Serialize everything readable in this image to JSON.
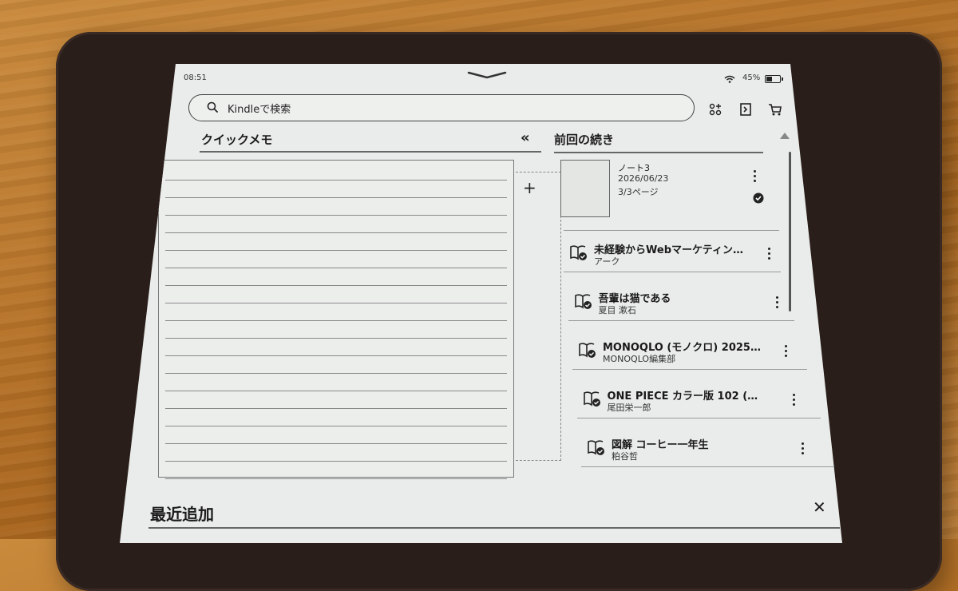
{
  "status": {
    "time": "08:51",
    "battery": "45%",
    "battery_level": 0.45
  },
  "search": {
    "placeholder": "Kindleで検索"
  },
  "toolbar": {
    "icons": [
      "grid-plus-icon",
      "library-icon",
      "cart-icon"
    ]
  },
  "quick_memo": {
    "title": "クイックメモ",
    "collapse_glyph": "«",
    "add_glyph": "+"
  },
  "continue_reading": {
    "title": "前回の続き",
    "note": {
      "title": "ノート3",
      "date": "2026/06/23",
      "pages": "3/3ページ"
    },
    "books": [
      {
        "title": "未経験からWebマーケティン…",
        "author": "アーク"
      },
      {
        "title": "吾輩は猫である",
        "author": "夏目 漱石"
      },
      {
        "title": "MONOQLO (モノクロ) 2025…",
        "author": "MONOQLO編集部"
      },
      {
        "title": "ONE PIECE カラー版 102 (…",
        "author": "尾田栄一郎"
      },
      {
        "title": "図解 コーヒー一年生",
        "author": "粕谷哲"
      }
    ]
  },
  "recently_added": {
    "title": "最近追加",
    "close_glyph": "✕"
  }
}
